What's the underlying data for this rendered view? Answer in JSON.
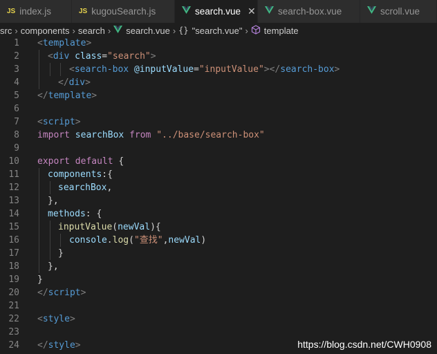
{
  "tabs": [
    {
      "label": "index.js",
      "icon": "JS",
      "active": false
    },
    {
      "label": "kugouSearch.js",
      "icon": "JS",
      "active": false
    },
    {
      "label": "search.vue",
      "icon": "vue",
      "active": true
    },
    {
      "label": "search-box.vue",
      "icon": "vue",
      "active": false
    },
    {
      "label": "scroll.vue",
      "icon": "vue",
      "active": false
    }
  ],
  "breadcrumb": {
    "parts": [
      "src",
      "components",
      "search",
      "search.vue",
      "\"search.vue\"",
      "template"
    ],
    "braces": "{}"
  },
  "colors": {
    "vue": "#41b883",
    "js": "#e8d44d",
    "bg": "#1e1e1e"
  },
  "code": {
    "lines": [
      {
        "n": "1",
        "text": ""
      },
      {
        "n": "2",
        "text": ""
      },
      {
        "n": "3",
        "text": ""
      },
      {
        "n": "4",
        "text": ""
      },
      {
        "n": "5",
        "text": ""
      },
      {
        "n": "6",
        "text": ""
      },
      {
        "n": "7",
        "text": ""
      },
      {
        "n": "8",
        "text": ""
      },
      {
        "n": "9",
        "text": ""
      },
      {
        "n": "10",
        "text": ""
      },
      {
        "n": "11",
        "text": ""
      },
      {
        "n": "12",
        "text": ""
      },
      {
        "n": "13",
        "text": ""
      },
      {
        "n": "14",
        "text": ""
      },
      {
        "n": "15",
        "text": ""
      },
      {
        "n": "16",
        "text": ""
      },
      {
        "n": "17",
        "text": ""
      },
      {
        "n": "18",
        "text": ""
      },
      {
        "n": "19",
        "text": ""
      },
      {
        "n": "20",
        "text": ""
      },
      {
        "n": "21",
        "text": ""
      },
      {
        "n": "22",
        "text": ""
      },
      {
        "n": "23",
        "text": ""
      },
      {
        "n": "24",
        "text": ""
      }
    ],
    "tokens": {
      "l1": [
        "<",
        "template",
        ">"
      ],
      "l2a": "<",
      "l2b": "div",
      "l2c": "class",
      "l2d": "=",
      "l2e": "\"search\"",
      "l2f": ">",
      "l3a": "<",
      "l3b": "search-box",
      "l3c": "@inputValue",
      "l3d": "=",
      "l3e": "\"inputValue\"",
      "l3f": "></",
      "l3g": "search-box",
      "l3h": ">",
      "l4a": "</",
      "l4b": "div",
      "l4c": ">",
      "l5a": "</",
      "l5b": "template",
      "l5c": ">",
      "l7a": "<",
      "l7b": "script",
      "l7c": ">",
      "l8a": "import",
      "l8b": "searchBox",
      "l8c": "from",
      "l8d": "\"../base/search-box\"",
      "l10a": "export",
      "l10b": "default",
      "l10c": "{",
      "l11a": "components",
      "l11b": ":{",
      "l12a": "searchBox",
      "l12b": ",",
      "l13": "},",
      "l14a": "methods",
      "l14b": ": {",
      "l15a": "inputValue",
      "l15b": "(",
      "l15c": "newVal",
      "l15d": "){",
      "l16a": "console",
      "l16b": ".",
      "l16c": "log",
      "l16d": "(",
      "l16e": "\"查找\"",
      "l16f": ",",
      "l16g": "newVal",
      "l16h": ")",
      "l17": "}",
      "l18": "},",
      "l19": "}",
      "l20a": "</",
      "l20b": "script",
      "l20c": ">",
      "l22a": "<",
      "l22b": "style",
      "l22c": ">",
      "l24a": "</",
      "l24b": "style",
      "l24c": ">"
    }
  },
  "watermark": "https://blog.csdn.net/CWH0908"
}
